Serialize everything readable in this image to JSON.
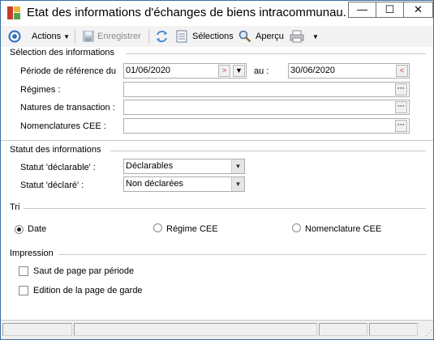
{
  "window": {
    "title": "Etat des informations d'échanges de biens intracommunau...",
    "minimize_glyph": "—",
    "maximize_glyph": "☐",
    "close_glyph": "✕"
  },
  "toolbar": {
    "actions_label": "Actions",
    "enregistrer_label": "Enregistrer",
    "selections_label": "Sélections",
    "apercu_label": "Aperçu"
  },
  "selection": {
    "section_title": "Sélection des informations",
    "periode_label": "Période de référence du",
    "periode_from": "01/06/2020",
    "au_label": "au :",
    "periode_to": "30/06/2020",
    "regimes_label": "Régimes :",
    "regimes_value": "",
    "natures_label": "Natures de transaction :",
    "natures_value": "",
    "nomenclatures_label": "Nomenclatures CEE :",
    "nomenclatures_value": ""
  },
  "statut": {
    "section_title": "Statut des informations",
    "declarable_label": "Statut 'déclarable' :",
    "declarable_value": "Déclarables",
    "declare_label": "Statut 'déclaré' :",
    "declare_value": "Non déclarées"
  },
  "tri": {
    "section_title": "Tri",
    "options": [
      {
        "label": "Date",
        "selected": true
      },
      {
        "label": "Régime CEE",
        "selected": false
      },
      {
        "label": "Nomenclature CEE",
        "selected": false
      }
    ]
  },
  "impression": {
    "section_title": "Impression",
    "saut_label": "Saut de page par période",
    "saut_checked": false,
    "edition_label": "Edition de la page de garde",
    "edition_checked": false
  },
  "icons": {
    "app": "app-logo-icon",
    "actions": "target-icon",
    "save": "save-icon",
    "refresh": "refresh-icon",
    "selections": "document-icon",
    "preview": "magnifier-icon",
    "print": "printer-icon"
  },
  "colors": {
    "window_border": "#3c6fa5",
    "toolbar_bg": "#f3f3f3",
    "accent_blue": "#2b6cc4"
  }
}
